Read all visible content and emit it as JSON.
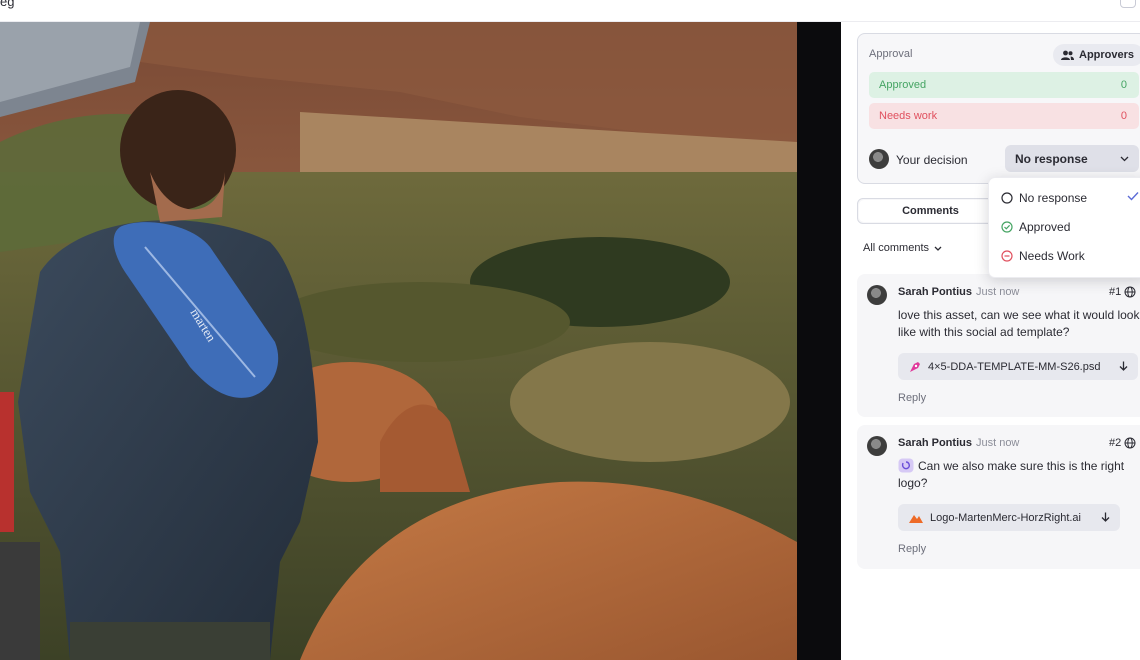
{
  "topbar": {
    "file_name": "eg"
  },
  "approval": {
    "title": "Approval",
    "approvers_button": "Approvers",
    "approved_label": "Approved",
    "approved_count": "0",
    "needs_work_label": "Needs work",
    "needs_work_count": "0",
    "your_decision_label": "Your decision",
    "decision_value": "No response"
  },
  "dropdown": {
    "options": [
      "No response",
      "Approved",
      "Needs Work"
    ],
    "selected": "No response"
  },
  "tabs": {
    "comments": "Comments"
  },
  "filter": {
    "label": "All comments"
  },
  "comments": [
    {
      "author": "Sarah Pontius",
      "time": "Just now",
      "number": "#1",
      "text": "love this asset, can we see what it would look like with this social ad template?",
      "attachment": "4×5-DDA-TEMPLATE-MM-S26.psd",
      "reply_label": "Reply"
    },
    {
      "author": "Sarah Pontius",
      "time": "Just now",
      "number": "#2",
      "text": "Can we also make sure this is the right logo?",
      "attachment": "Logo-MartenMerc-HorzRight.ai",
      "reply_label": "Reply"
    }
  ],
  "photo": {
    "bag_brand": "marten"
  },
  "colors": {
    "approved_bg": "#ddf1e4",
    "approved_text": "#45a463",
    "needs_work_bg": "#f8e1e3",
    "needs_work_text": "#e0505e",
    "check_accent": "#5b6bd6"
  },
  "icons": [
    "people-icon",
    "chevron-down-icon",
    "circle-icon",
    "check-circle-icon",
    "minus-circle-icon",
    "checkmark-icon",
    "globe-icon",
    "download-icon",
    "pen-tool-icon",
    "logo-icon",
    "file-photoshop-icon",
    "file-illustrator-icon"
  ]
}
